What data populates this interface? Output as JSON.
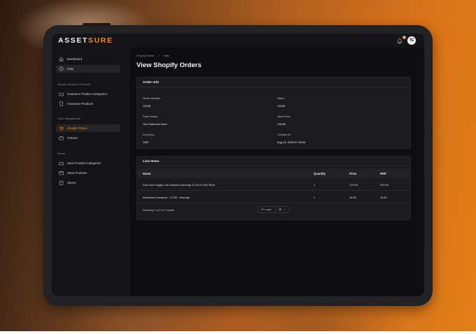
{
  "app": {
    "logo_main": "ASSET",
    "logo_accent": "SURE",
    "notification_count": "1",
    "user_initials": "TE"
  },
  "sidebar": {
    "top_items": [
      {
        "label": "Dashboard",
        "icon": "home-icon"
      },
      {
        "label": "Help",
        "icon": "help-icon"
      }
    ],
    "sections": [
      {
        "title": "Shopify Insurance Products",
        "items": [
          {
            "label": "Insurance Product Categories"
          },
          {
            "label": "Insurance Products"
          }
        ]
      },
      {
        "title": "Order Management",
        "items": [
          {
            "label": "Shopify Orders"
          },
          {
            "label": "Policies"
          }
        ]
      },
      {
        "title": "Stores",
        "items": [
          {
            "label": "Store Product Categories"
          },
          {
            "label": "Store Products"
          },
          {
            "label": "Stores"
          }
        ]
      }
    ]
  },
  "breadcrumb": {
    "parent": "Shopify Orders",
    "separator": "/",
    "current": "View"
  },
  "page": {
    "title": "View Shopify Orders"
  },
  "order_info": {
    "title": "Order Info",
    "fields": [
      {
        "label": "Order Number",
        "value": "12345"
      },
      {
        "label": "Name",
        "value": "12345"
      },
      {
        "label": "Store Name",
        "value": "The Diamond Store"
      },
      {
        "label": "Total Price",
        "value": "195.80"
      },
      {
        "label": "Currency",
        "value": "GBP"
      },
      {
        "label": "Created At",
        "value": "Aug 20, 2025 07:50:54"
      }
    ]
  },
  "line_items": {
    "title": "Line Items",
    "columns": [
      "Name",
      "Quantity",
      "Price",
      "RRP"
    ],
    "rows": [
      [
        "Duo Row Huggie Lab Diamond Earrings 0.22ct in 925 Silver",
        "1",
        "179.00",
        "239.00"
      ],
      [
        "Assetsure Insurance - 0-250 - Earrings",
        "1",
        "16.80",
        "16.80"
      ]
    ],
    "summary": "Showing 1 to 2 of 2 results",
    "per_page_label": "Per page",
    "per_page_value": "10"
  },
  "colors": {
    "accent": "#f08c2c",
    "background": "#0e0e10",
    "card": "#1b1b1e"
  }
}
